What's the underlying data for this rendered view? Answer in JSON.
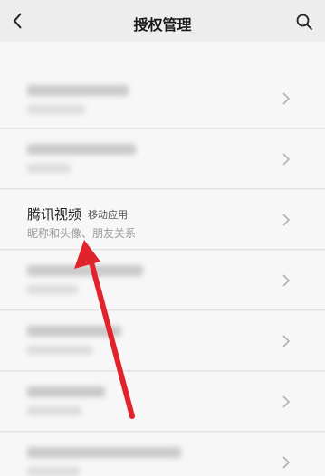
{
  "header": {
    "title": "授权管理"
  },
  "highlighted_item": {
    "name": "腾讯视频",
    "tag": "移动应用",
    "description": "昵称和头像、朋友关系"
  },
  "colors": {
    "background": "#ededed",
    "card": "#f7f7f7",
    "arrow": "#e0242b"
  },
  "icons": {
    "back": "chevron-left-icon",
    "search": "search-icon",
    "row_chevron": "chevron-right-icon"
  }
}
